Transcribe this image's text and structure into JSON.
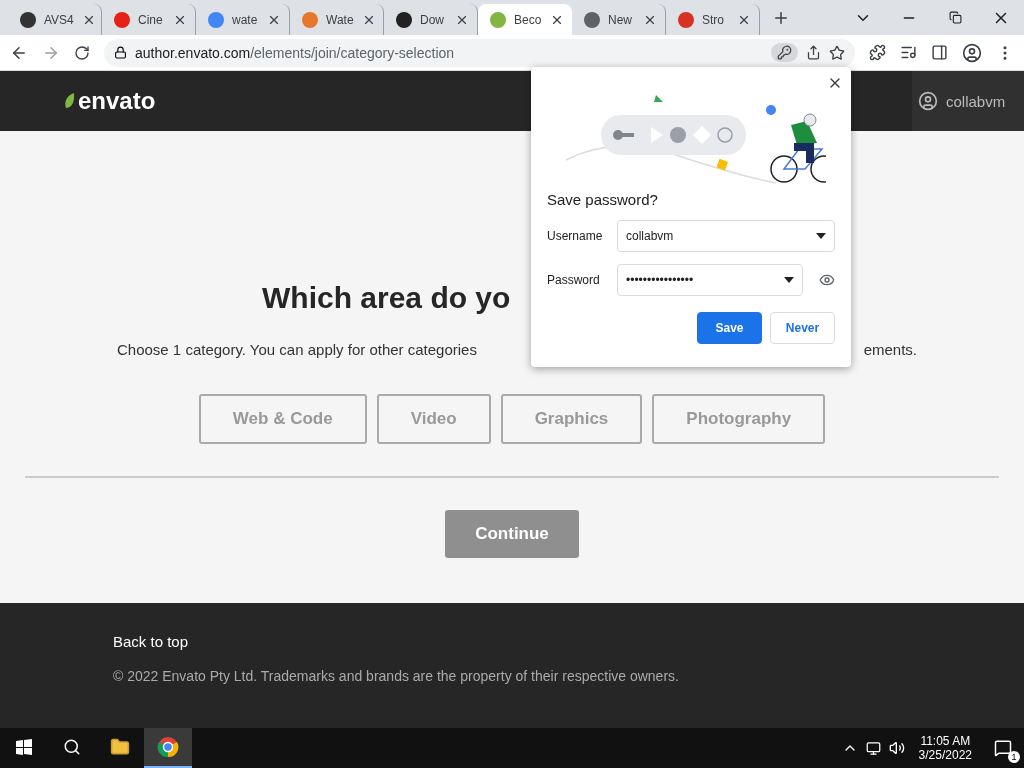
{
  "browser": {
    "tabs": [
      {
        "title": "AVS4",
        "color": "#333333",
        "selected": false
      },
      {
        "title": "Cine",
        "color": "#e62117",
        "selected": false
      },
      {
        "title": "wate",
        "color": "#4285f4",
        "selected": false
      },
      {
        "title": "Wate",
        "color": "#e8772e",
        "selected": false
      },
      {
        "title": "Dow",
        "color": "#222222",
        "selected": false
      },
      {
        "title": "Beco",
        "color": "#82b541",
        "selected": true
      },
      {
        "title": "New",
        "color": "#5f6368",
        "selected": false
      },
      {
        "title": "Stro",
        "color": "#d93025",
        "selected": false
      }
    ],
    "url_host": "author.envato.com",
    "url_path": "/elements/join/category-selection"
  },
  "header": {
    "logo": "envato",
    "user": "collabvm"
  },
  "main": {
    "heading": "Which area do yo",
    "subtitle_start": "Choose 1 category. You can apply for other categories",
    "subtitle_end": "ements.",
    "categories": [
      {
        "label": "Web & Code",
        "selected": false
      },
      {
        "label": "Video",
        "selected": false
      },
      {
        "label": "Graphics",
        "selected": false
      },
      {
        "label": "Photography",
        "selected": false
      }
    ],
    "continue": {
      "label": "Continue",
      "disabled": true
    }
  },
  "footer": {
    "link": "Back to top",
    "copyright": "© 2022 Envato Pty Ltd. Trademarks and brands are the property of their respective owners."
  },
  "password_popup": {
    "title": "Save password?",
    "username_label": "Username",
    "username": "collabvm",
    "password_label": "Password",
    "password": "••••••••••••••••",
    "save": "Save",
    "never": "Never"
  },
  "taskbar": {
    "apps": [
      {
        "kind": "explorer",
        "active": false
      },
      {
        "kind": "chrome",
        "active": true
      }
    ],
    "time": "11:05 AM",
    "date": "3/25/2022",
    "notifications": "1"
  }
}
